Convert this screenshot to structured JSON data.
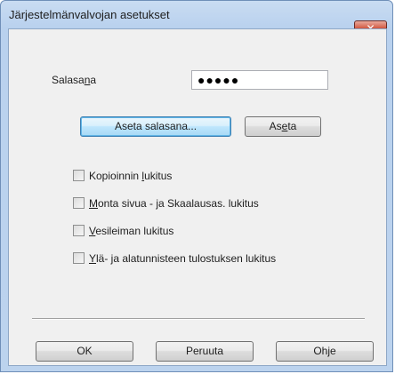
{
  "window": {
    "title": "Järjestelmänvalvojan asetukset",
    "close_glyph": "✕"
  },
  "password": {
    "label_before": "Salasa",
    "label_mnemonic": "n",
    "label_after": "a",
    "value": "●●●●●"
  },
  "buttons": {
    "set_password": "Aseta salasana...",
    "set_before": "As",
    "set_mnemonic": "e",
    "set_after": "ta",
    "ok": "OK",
    "cancel": "Peruuta",
    "help_before": "Oh",
    "help_mnemonic": "j",
    "help_after": "e"
  },
  "checkboxes": [
    {
      "before": "Kopioinnin ",
      "mnemonic": "l",
      "after": "ukitus",
      "checked": false
    },
    {
      "before": "",
      "mnemonic": "M",
      "after": "onta sivua - ja Skaalausas. lukitus",
      "checked": false
    },
    {
      "before": "",
      "mnemonic": "V",
      "after": "esileiman lukitus",
      "checked": false
    },
    {
      "before": "",
      "mnemonic": "Y",
      "after": "lä- ja alatunnisteen tulostuksen lukitus",
      "checked": false
    }
  ],
  "colors": {
    "close_red": "#c23a20",
    "titlebar_blue": "#bcd3ee",
    "dialog_gray": "#f0f0f0"
  }
}
